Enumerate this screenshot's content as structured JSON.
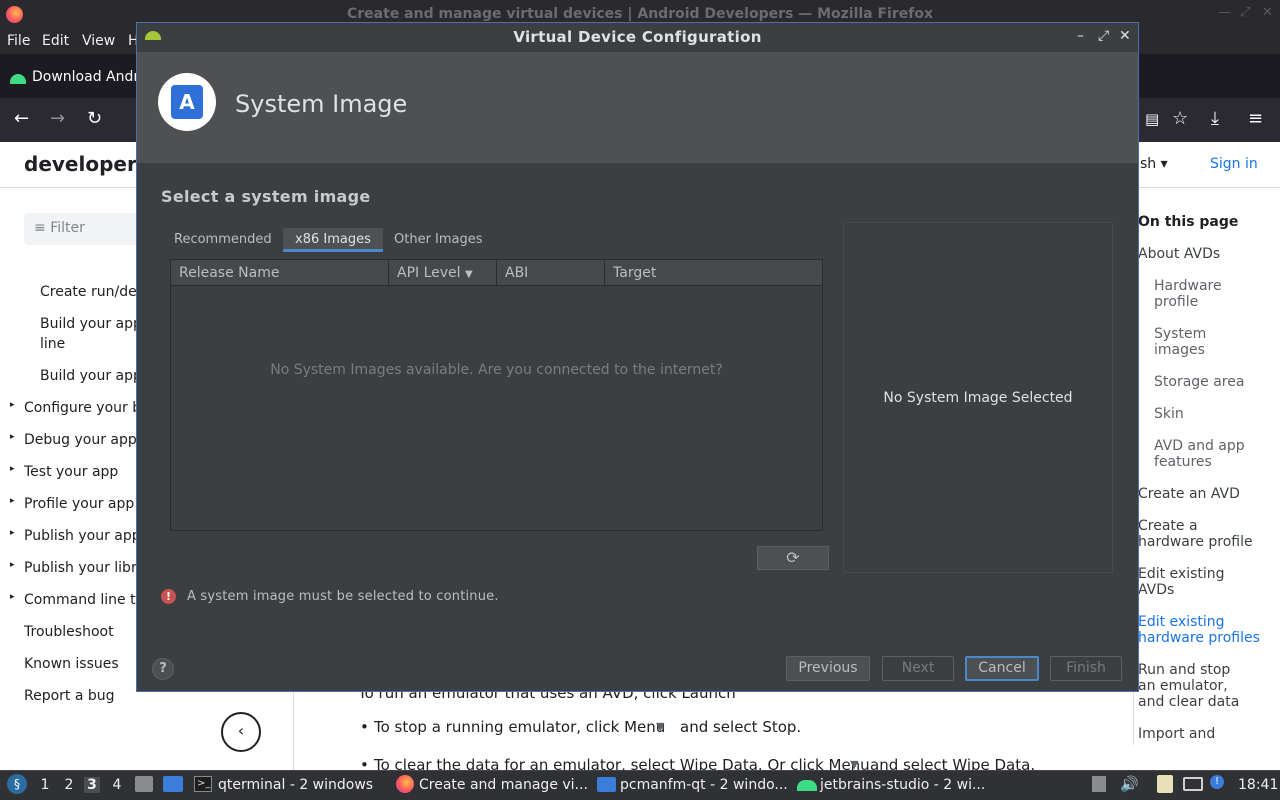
{
  "firefox": {
    "window_title": "Create and manage virtual devices  |  Android Developers — Mozilla Firefox",
    "menu": [
      "File",
      "Edit",
      "View",
      "H"
    ],
    "tab_label": "Download Andro",
    "header": {
      "logo_text": "developers",
      "language": "sh",
      "sign_in": "Sign in"
    },
    "filter_placeholder": "Filter",
    "left_nav": [
      "Create run/debu",
      "Build your app f",
      "line",
      "Build your app f",
      "Configure your bu",
      "Debug your app",
      "Test your app",
      "Profile your app",
      "Publish your app",
      "Publish your librar",
      "Command line too",
      "Troubleshoot",
      "Known issues",
      "Report a bug"
    ],
    "article_lines": [
      "To run an emulator that uses an AVD, click Launch",
      "To stop a running emulator, click Menu",
      "and select Stop.",
      "To clear the data for an emulator, select Wipe Data. Or click Menu",
      "and select Wipe Data."
    ],
    "on_this_page": {
      "title": "On this page",
      "items": [
        "About AVDs",
        "Hardware profile",
        "System images",
        "Storage area",
        "Skin",
        "AVD and app features",
        "Create an AVD",
        "Create a hardware profile",
        "Edit existing AVDs",
        "Edit existing hardware profiles",
        "Run and stop an emulator, and clear data",
        "Import and"
      ]
    }
  },
  "dialog": {
    "title": "Virtual Device Configuration",
    "header_title": "System Image",
    "section_title": "Select a system image",
    "tabs": [
      "Recommended",
      "x86 Images",
      "Other Images"
    ],
    "selected_tab": "x86 Images",
    "table_columns": [
      "Release Name",
      "API Level",
      "ABI",
      "Target"
    ],
    "sort_column": "API Level",
    "empty_message": "No System Images available. Are you connected to the internet?",
    "detail_message": "No System Image Selected",
    "error_message": "A system image must be selected to continue.",
    "buttons": {
      "help": "?",
      "previous": "Previous",
      "next": "Next",
      "cancel": "Cancel",
      "finish": "Finish"
    }
  },
  "taskbar": {
    "workspaces": [
      "1",
      "2",
      "3",
      "4"
    ],
    "active_workspace": "3",
    "apps": [
      "qterminal - 2 windows",
      "Create and manage vi...",
      "pcmanfm-qt - 2 windo...",
      "jetbrains-studio - 2 wi..."
    ],
    "clock": "18:41"
  }
}
